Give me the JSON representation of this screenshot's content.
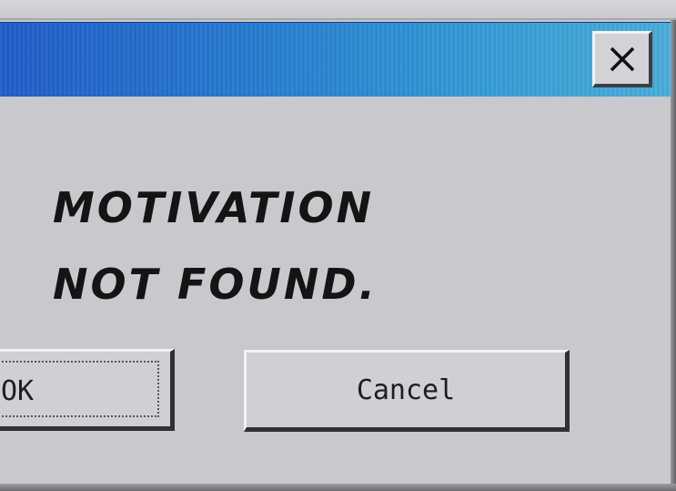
{
  "dialog": {
    "message_line1": "Motivation",
    "message_line2": "not found.",
    "ok_label": "OK",
    "cancel_label": "Cancel",
    "close_symbol": "×"
  },
  "colors": {
    "titlebar_left": "#1f5bc7",
    "titlebar_right": "#48acd9",
    "window_bg": "#c8c9cc"
  },
  "icons": {
    "close": "close-icon"
  }
}
